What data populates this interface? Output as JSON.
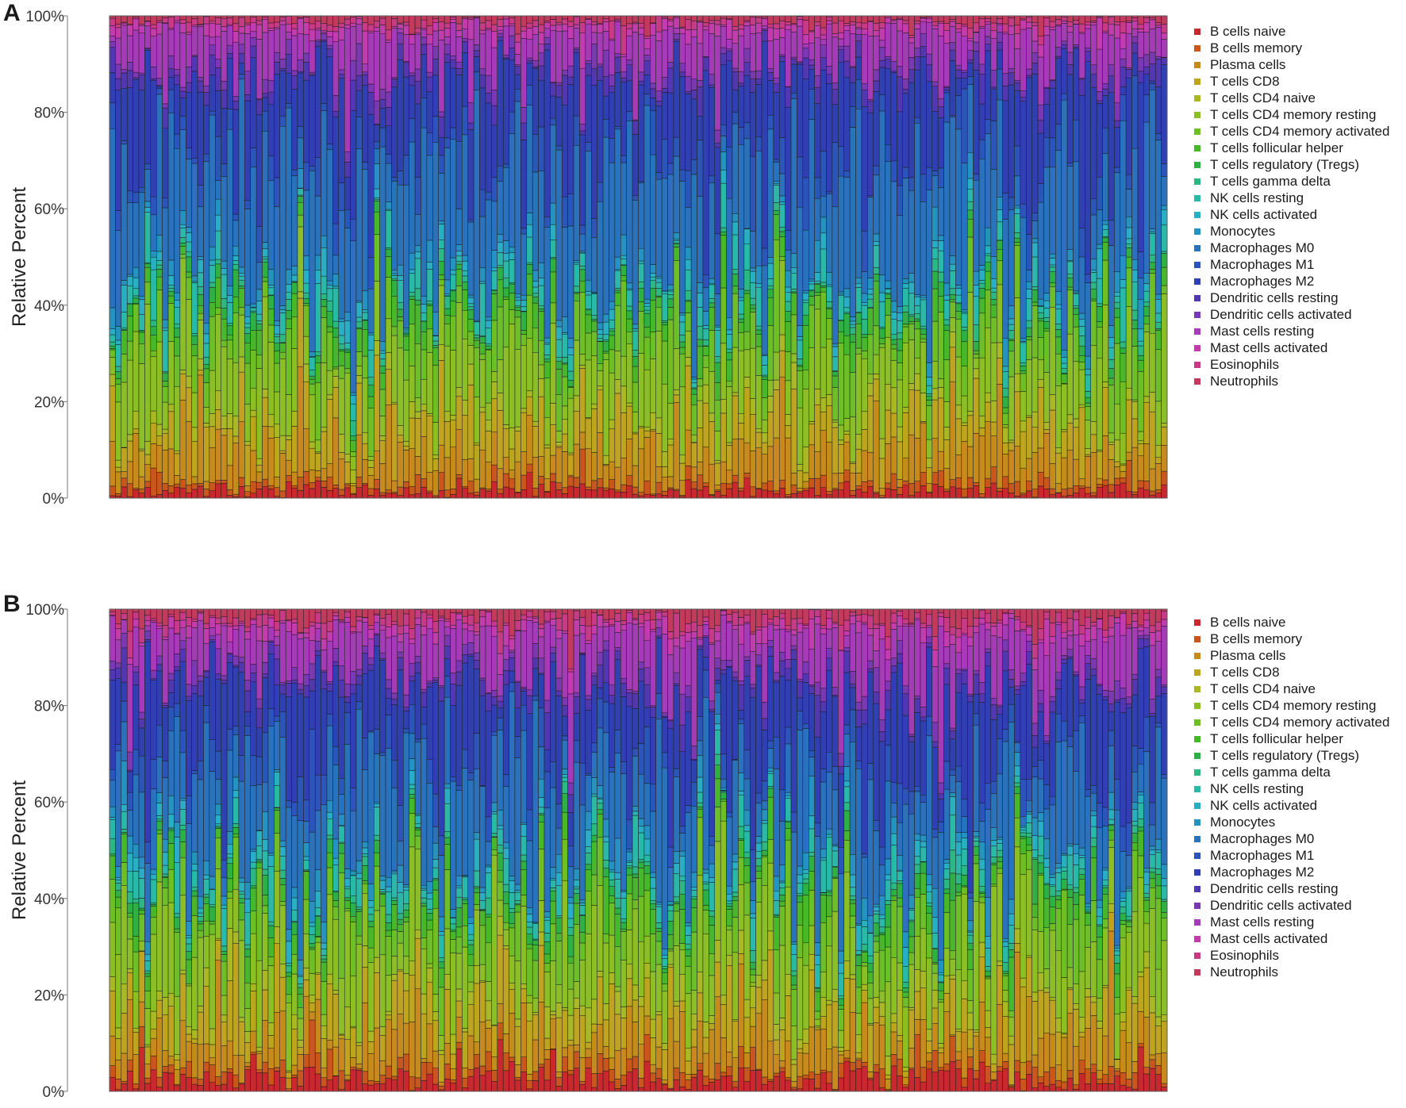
{
  "cell_types": [
    "B cells naive",
    "B cells memory",
    "Plasma cells",
    "T cells CD8",
    "T cells CD4 naive",
    "T cells CD4 memory resting",
    "T cells CD4 memory activated",
    "T cells follicular helper",
    "T cells regulatory (Tregs)",
    "T cells gamma delta",
    "NK cells resting",
    "NK cells activated",
    "Monocytes",
    "Macrophages M0",
    "Macrophages M1",
    "Macrophages M2",
    "Dendritic cells resting",
    "Dendritic cells activated",
    "Mast cells resting",
    "Mast cells activated",
    "Eosinophils",
    "Neutrophils"
  ],
  "colors": [
    "#c8282e",
    "#c9561d",
    "#c78a1d",
    "#bfa41f",
    "#a9b824",
    "#8cbf26",
    "#6ebe28",
    "#48b72c",
    "#2fb045",
    "#2db783",
    "#2ab8a8",
    "#2aaec4",
    "#2592c0",
    "#2a72bb",
    "#2b55b8",
    "#3040b2",
    "#5238b0",
    "#7a38b3",
    "#a63bb8",
    "#c13cad",
    "#c63a86",
    "#c23a5c"
  ],
  "panels": [
    {
      "letter": "A",
      "ylabel": "Relative Percent",
      "yticks": [
        "0%",
        "20%",
        "40%",
        "60%",
        "80%",
        "100%"
      ],
      "legend": [
        "B cells naive",
        "B cells memory",
        "Plasma cells",
        "T cells CD8",
        "T cells CD4 naive",
        "T cells CD4 memory resting",
        "T cells CD4 memory activated",
        "T cells follicular helper",
        "T cells regulatory (Tregs)",
        "T cells gamma delta",
        "NK cells resting",
        "NK cells activated",
        "Monocytes",
        "Macrophages M0",
        "Macrophages M1",
        "Macrophages M2",
        "Dendritic cells resting",
        "Dendritic cells activated",
        "Mast cells resting",
        "Mast cells activated",
        "Eosinophils",
        "Neutrophils"
      ]
    },
    {
      "letter": "B",
      "ylabel": "Relative Percent",
      "yticks": [
        "0%",
        "20%",
        "40%",
        "60%",
        "80%",
        "100%"
      ],
      "legend": [
        "B cells naive",
        "B cells memory",
        "Plasma cells",
        "T cells CD8",
        "T cells CD4 naive",
        "T cells CD4 memory resting",
        "T cells CD4 memory activated",
        "T cells follicular helper",
        "T cells regulatory (Tregs)",
        "T cells gamma delta",
        "NK cells resting",
        "NK cells activated",
        "Monocytes",
        "Macrophages M0",
        "Macrophages M1",
        "Macrophages M2",
        "Dendritic cells resting",
        "Dendritic cells activated",
        "Mast cells resting",
        "Mast cells activated",
        "Eosinophils",
        "Neutrophils"
      ]
    }
  ],
  "chart_data": [
    {
      "type": "bar",
      "stacked": true,
      "normalized": true,
      "n_samples": 180,
      "title": "",
      "xlabel": "",
      "ylabel": "Relative Percent",
      "ylim": [
        0,
        100
      ],
      "yticks": [
        "0%",
        "20%",
        "40%",
        "60%",
        "80%",
        "100%"
      ],
      "legend_position": "right",
      "series_names": [
        "B cells naive",
        "B cells memory",
        "Plasma cells",
        "T cells CD8",
        "T cells CD4 naive",
        "T cells CD4 memory resting",
        "T cells CD4 memory activated",
        "T cells follicular helper",
        "T cells regulatory (Tregs)",
        "T cells gamma delta",
        "NK cells resting",
        "NK cells activated",
        "Monocytes",
        "Macrophages M0",
        "Macrophages M1",
        "Macrophages M2",
        "Dendritic cells resting",
        "Dendritic cells activated",
        "Mast cells resting",
        "Mast cells activated",
        "Eosinophils",
        "Neutrophils"
      ],
      "note_values": "approximate mean composition per cell type (% of sample), estimated from visual inspection",
      "mean_percent": [
        1.5,
        1.5,
        6,
        6,
        2,
        10,
        6,
        3,
        1.5,
        1,
        3,
        1.5,
        2,
        21,
        4,
        14,
        2,
        1.5,
        6,
        1.5,
        1,
        1
      ]
    },
    {
      "type": "bar",
      "stacked": true,
      "normalized": true,
      "n_samples": 180,
      "title": "",
      "xlabel": "",
      "ylabel": "Relative Percent",
      "ylim": [
        0,
        100
      ],
      "yticks": [
        "0%",
        "20%",
        "40%",
        "60%",
        "80%",
        "100%"
      ],
      "legend_position": "right",
      "series_names": [
        "B cells naive",
        "B cells memory",
        "Plasma cells",
        "T cells CD8",
        "T cells CD4 naive",
        "T cells CD4 memory resting",
        "T cells CD4 memory activated",
        "T cells follicular helper",
        "T cells regulatory (Tregs)",
        "T cells gamma delta",
        "NK cells resting",
        "NK cells activated",
        "Monocytes",
        "Macrophages M0",
        "Macrophages M1",
        "Macrophages M2",
        "Dendritic cells resting",
        "Dendritic cells activated",
        "Mast cells resting",
        "Mast cells activated",
        "Eosinophils",
        "Neutrophils"
      ],
      "note_values": "approximate mean composition per cell type (% of sample), estimated from visual inspection",
      "mean_percent": [
        2.5,
        2,
        6,
        6,
        2,
        11,
        6,
        3,
        1.5,
        1,
        3,
        1.5,
        2,
        17,
        4,
        14,
        2,
        1.5,
        8,
        1.5,
        1.5,
        2
      ]
    }
  ]
}
